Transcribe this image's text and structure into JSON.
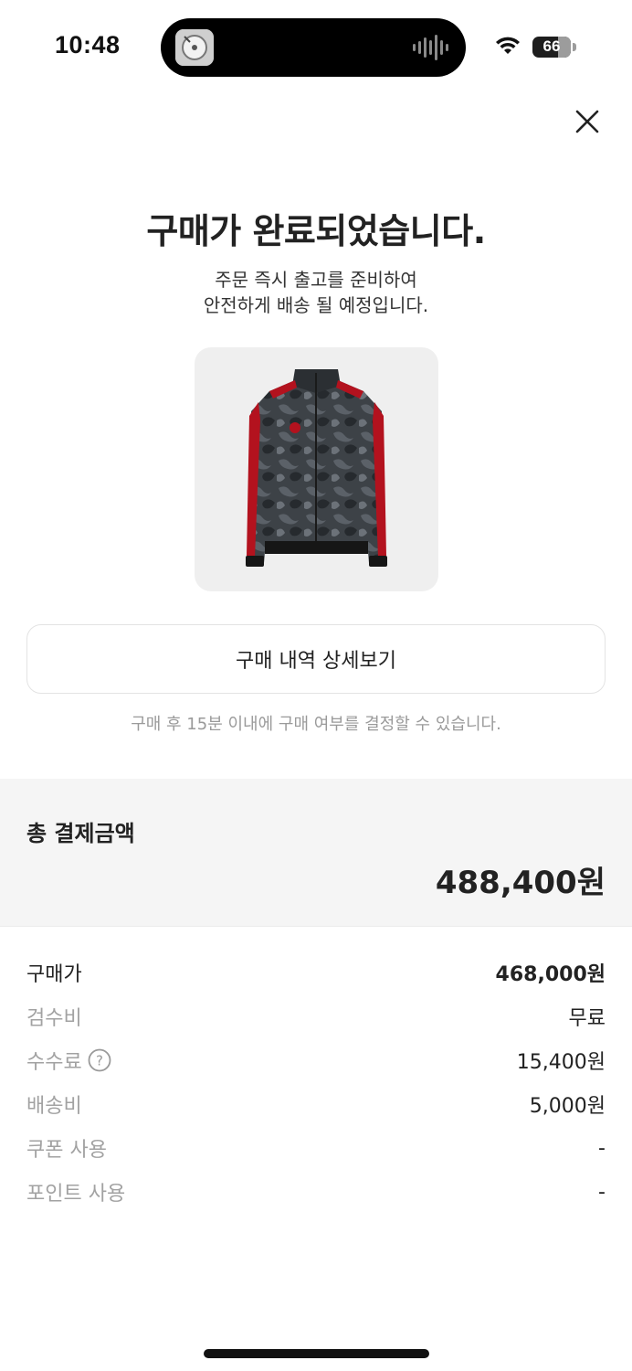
{
  "status_bar": {
    "time": "10:48",
    "battery": "66",
    "battery_level": 0.66
  },
  "header": {
    "close_icon": "close-icon"
  },
  "completion": {
    "title": "구매가 완료되었습니다.",
    "subtitle_line1": "주문 즉시 출고를 준비하여",
    "subtitle_line2": "안전하게 배송 될 예정입니다."
  },
  "product": {
    "image": "track-jacket-image"
  },
  "actions": {
    "detail_button_label": "구매 내역 상세보기",
    "notice": "구매 후 15분 이내에 구매 여부를 결정할 수 있습니다."
  },
  "total": {
    "label": "총 결제금액",
    "amount": "488,400원"
  },
  "breakdown": [
    {
      "label": "구매가",
      "value": "468,000원"
    },
    {
      "label": "검수비",
      "value": "무료"
    },
    {
      "label": "수수료",
      "value": "15,400원"
    },
    {
      "label": "배송비",
      "value": "5,000원"
    },
    {
      "label": "쿠폰 사용",
      "value": "-"
    },
    {
      "label": "포인트 사용",
      "value": "-"
    }
  ],
  "colors": {
    "accent_panel": "#f5f5f5",
    "text": "#222222",
    "muted": "#a2a2a2",
    "jacket_trim": "#b3121e"
  }
}
